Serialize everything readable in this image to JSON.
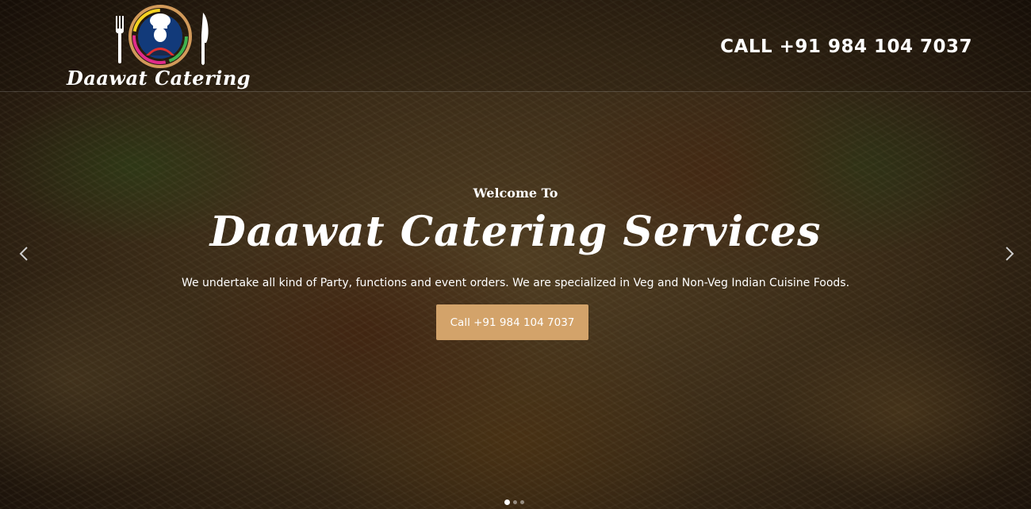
{
  "header": {
    "logo_text": "Daawat Catering",
    "call_label": "CALL +91 984 104 7037"
  },
  "hero": {
    "welcome": "Welcome To",
    "title": "Daawat Catering Services",
    "subtitle": "We undertake all kind of Party, functions and event orders. We are specialized in Veg and Non-Veg Indian Cuisine Foods.",
    "cta_label": "Call +91 984 104 7037"
  },
  "carousel": {
    "slide_count": 3,
    "active_slide": 1,
    "prev_icon": "chevron-left-icon",
    "next_icon": "chevron-right-icon"
  },
  "colors": {
    "accent": "#d3a36a",
    "text": "#ffffff"
  },
  "icons": {
    "logo_icons": [
      "fork-icon",
      "chef-icon",
      "knife-icon"
    ]
  }
}
